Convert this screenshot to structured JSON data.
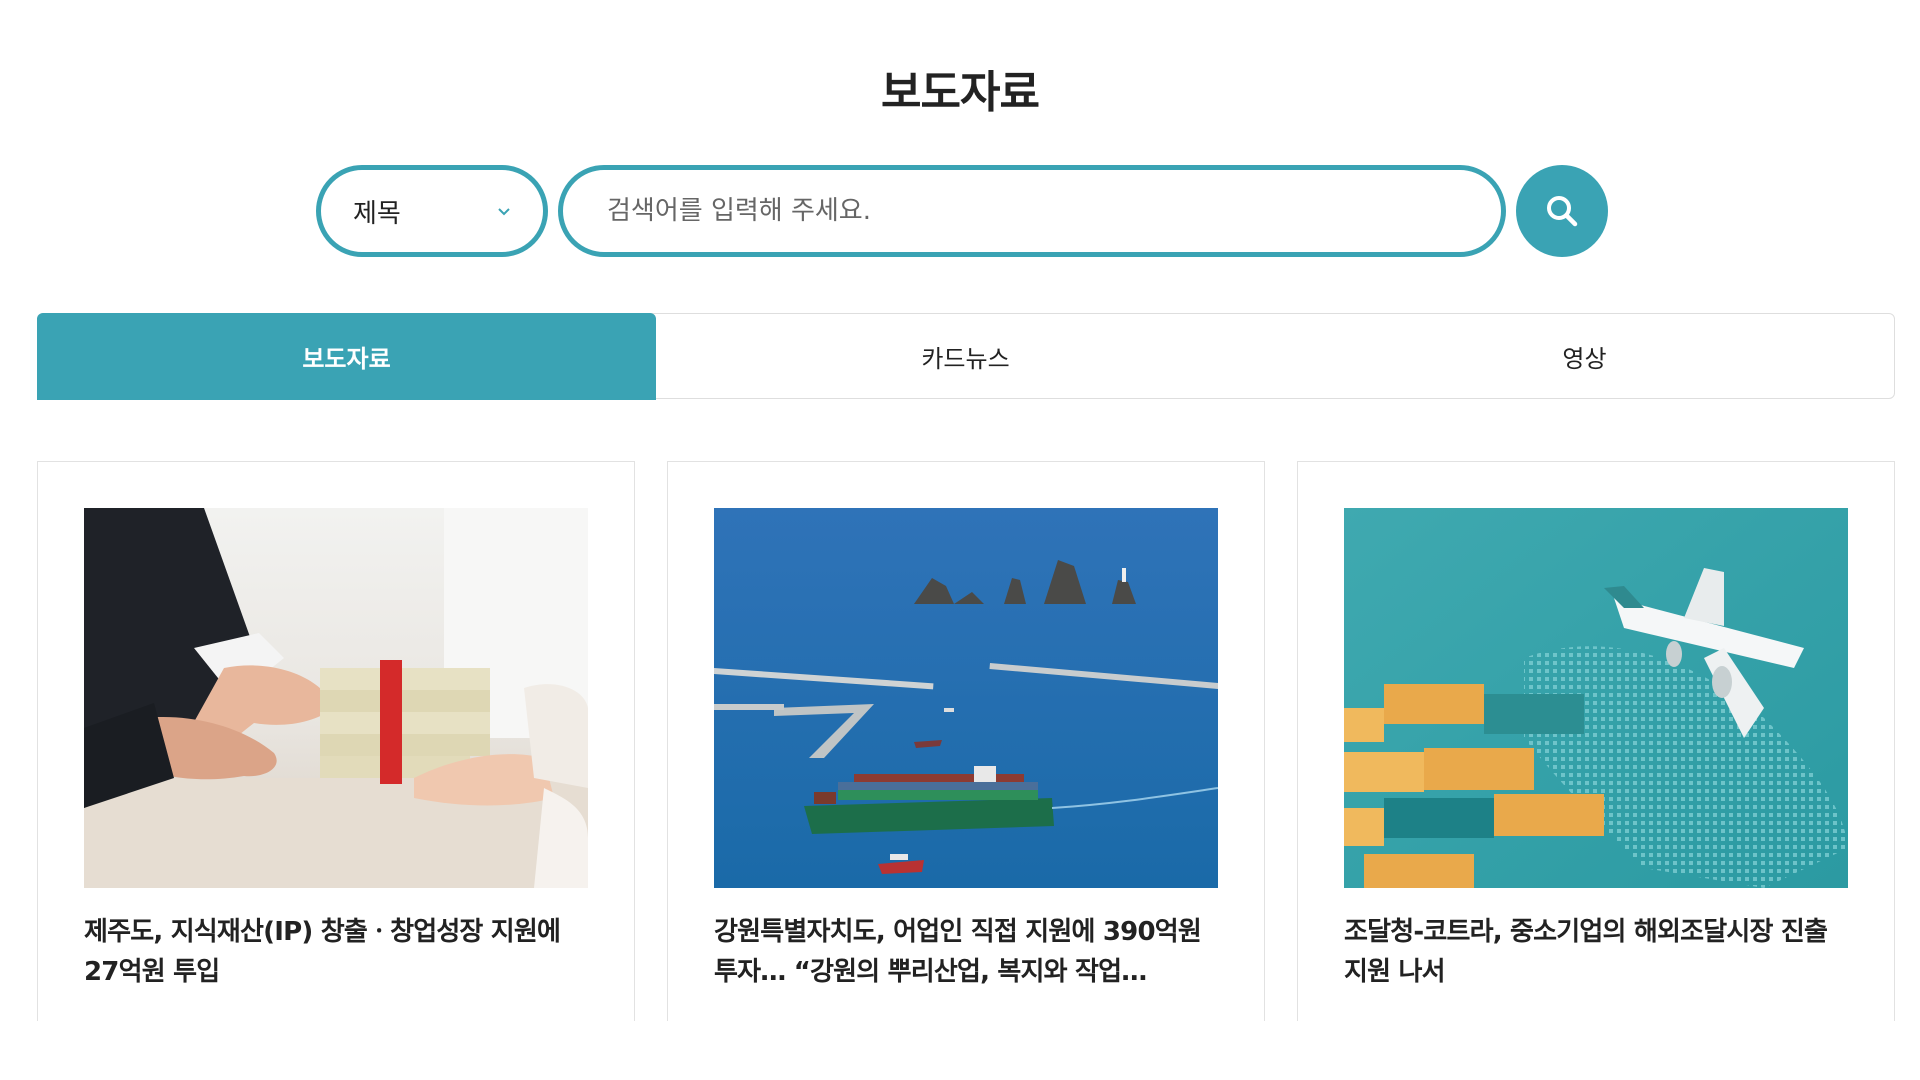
{
  "page": {
    "title": "보도자료"
  },
  "search": {
    "select_value": "제목",
    "placeholder": "검색어를 입력해 주세요.",
    "value": ""
  },
  "tabs": [
    {
      "label": "보도자료",
      "active": true
    },
    {
      "label": "카드뉴스",
      "active": false
    },
    {
      "label": "영상",
      "active": false
    }
  ],
  "cards": [
    {
      "title": "제주도, 지식재산(IP) 창출ㆍ창업성장 지원에 27억원 투입",
      "image": "money-handover-photo"
    },
    {
      "title": "강원특별자치도, 어업인 직접 지원에 390억원 투자… “강원의 뿌리산업, 복지와 작업…",
      "image": "harbor-container-ship-photo"
    },
    {
      "title": "조달청-코트라, 중소기업의 해외조달시장 진출 지원 나서",
      "image": "airplane-containers-photo"
    }
  ],
  "colors": {
    "accent": "#3aa3b4"
  },
  "icons": {
    "select": "chevron-down-icon",
    "search": "search-icon"
  }
}
